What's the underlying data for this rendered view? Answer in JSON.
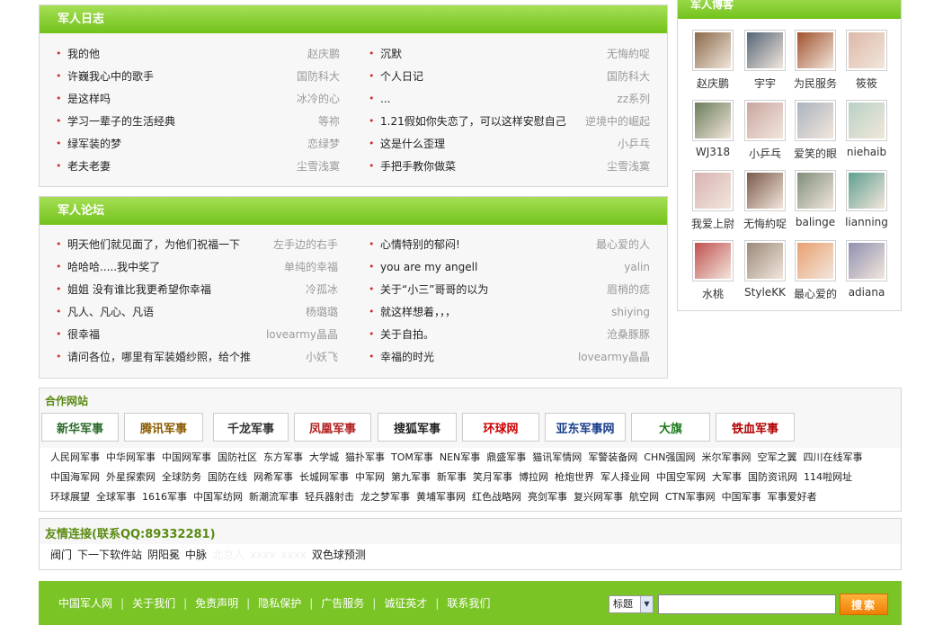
{
  "diary": {
    "title": "军人日志",
    "left": [
      {
        "title": "我的他",
        "author": "赵庆鹏"
      },
      {
        "title": "许巍我心中的歌手",
        "author": "国防科大"
      },
      {
        "title": "是这样吗",
        "author": "冰冷的心"
      },
      {
        "title": "学习一辈子的生活经典",
        "author": "等祢"
      },
      {
        "title": "绿军装的梦",
        "author": "恋绿梦"
      },
      {
        "title": "老夫老妻",
        "author": "尘雪浅寞"
      }
    ],
    "right": [
      {
        "title": "沉默",
        "author": "无悔約哫"
      },
      {
        "title": "个人日记",
        "author": "国防科大"
      },
      {
        "title": "...",
        "author": "zz系列"
      },
      {
        "title": "1.21假如你失恋了，可以这样安慰自己",
        "author": "逆境中的崛起"
      },
      {
        "title": "这是什么歪理",
        "author": "小乒乓"
      },
      {
        "title": "手把手教你做菜",
        "author": "尘雪浅寞"
      }
    ]
  },
  "forum": {
    "title": "军人论坛",
    "left": [
      {
        "title": "明天他们就见面了，为他们祝福一下",
        "author": "左手边的右手"
      },
      {
        "title": "哈哈哈.....我中奖了",
        "author": "单纯的幸福"
      },
      {
        "title": "姐姐 没有谁比我更希望你幸福",
        "author": "冷孤冰"
      },
      {
        "title": "凡人、凡心、凡语",
        "author": "杨璐璐"
      },
      {
        "title": "很幸福",
        "author": "lovearmy晶晶"
      },
      {
        "title": "请问各位，哪里有军装婚纱照，给个推",
        "author": "小妖飞"
      }
    ],
    "right": [
      {
        "title": "心情特别的郁闷!",
        "author": "最心爱的人"
      },
      {
        "title": "you are my angell",
        "author": "yalin"
      },
      {
        "title": "关于“小三”哥哥的以为",
        "author": "眉梢的痣"
      },
      {
        "title": "就这样想着，，，",
        "author": "shiying"
      },
      {
        "title": "关于自拍。",
        "author": "沧桑豚豚"
      },
      {
        "title": "幸福的时光",
        "author": "lovearmy晶晶"
      }
    ]
  },
  "blog": {
    "title": "军人博客",
    "users": [
      {
        "name": "赵庆鹏",
        "color": "#8a6a4a"
      },
      {
        "name": "宇宇",
        "color": "#556677"
      },
      {
        "name": "为民服务",
        "color": "#a0522d"
      },
      {
        "name": "筱筱",
        "color": "#dcb8a8"
      },
      {
        "name": "WJ318",
        "color": "#6b7d5a"
      },
      {
        "name": "小乒乓",
        "color": "#c9a6a0"
      },
      {
        "name": "爱笑的眼",
        "color": "#aab4bf"
      },
      {
        "name": "niehaib",
        "color": "#b7d2c4"
      },
      {
        "name": "我爱上尉",
        "color": "#d8b3b3"
      },
      {
        "name": "无悔約哫",
        "color": "#7a5a4a"
      },
      {
        "name": "balinge",
        "color": "#7f8f7a"
      },
      {
        "name": "lianning",
        "color": "#5f9f8f"
      },
      {
        "name": "水桃",
        "color": "#c05050"
      },
      {
        "name": "StyleKK",
        "color": "#9a8a7a"
      },
      {
        "name": "最心爱的",
        "color": "#e8a070"
      },
      {
        "name": "adiana",
        "color": "#9090b0"
      }
    ]
  },
  "partners": {
    "title": "合作网站",
    "logos": [
      {
        "label": "新华军事",
        "color": "#2a6a2a"
      },
      {
        "label": "腾讯军事",
        "color": "#8a5a00"
      },
      {
        "label": "千龙军事",
        "color": "#333333"
      },
      {
        "label": "凤凰军事",
        "color": "#b02020"
      },
      {
        "label": "搜狐军事",
        "color": "#222222"
      },
      {
        "label": "环球网",
        "color": "#cc0000"
      },
      {
        "label": "亚东军事网",
        "color": "#1a3e8a"
      },
      {
        "label": "大旗",
        "color": "#1d7a1d"
      },
      {
        "label": "铁血军事",
        "color": "#b00000"
      }
    ],
    "lines": [
      [
        "人民网军事",
        "中华网军事",
        "中国网军事",
        "国防社区",
        "东方军事",
        "大学城",
        "猫扑军事",
        "TOM军事",
        "NEN军事",
        "鼎盛军事",
        "猫讯军情网",
        "军警装备网",
        "CHN强国网",
        "米尔军事网",
        "空军之翼",
        "四川在线军事"
      ],
      [
        "中国海军网",
        "外星探索网",
        "全球防务",
        "国防在线",
        "网希军事",
        "长城网军事",
        "中军网",
        "第九军事",
        "新军事",
        "笑月军事",
        "博拉网",
        "枪炮世界",
        "军人择业网",
        "中国空军网",
        "大军事",
        "国防资讯网",
        "114啦网址"
      ],
      [
        "环球展望",
        "全球军事",
        "1616军事",
        "中国军纺网",
        "新潮流军事",
        "轻兵器射击",
        "龙之梦军事",
        "黄埔军事网",
        "红色战略网",
        "亮剑军事",
        "复兴网军事",
        "航空网",
        "CTN军事网",
        "中国军事",
        "军事爱好者"
      ]
    ]
  },
  "friends": {
    "title": "友情连接(联系QQ:89332281)",
    "links": [
      "阀门",
      "下一下软件站",
      "阴阳冕",
      "中脉"
    ],
    "faint_links": [
      "北京人",
      "xxxx",
      "xxxx"
    ],
    "tail_link": "双色球预测"
  },
  "footer": {
    "links": [
      "中国军人网",
      "关于我们",
      "免责声明",
      "隐私保护",
      "广告服务",
      "诚征英才",
      "联系我们"
    ],
    "separator": "|",
    "select_value": "标题",
    "search_button": "搜索"
  }
}
